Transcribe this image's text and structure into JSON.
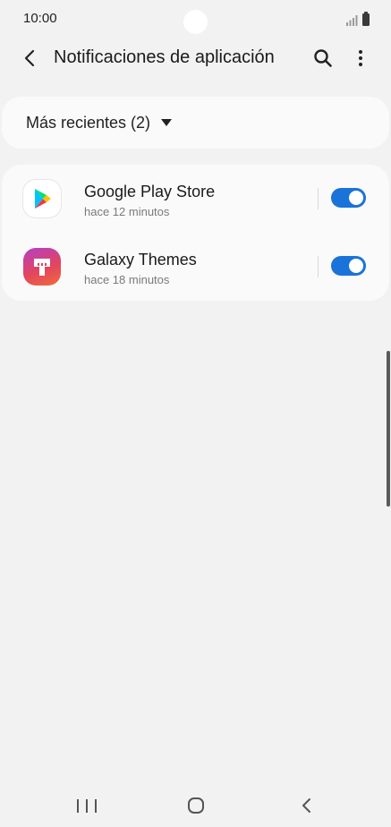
{
  "status_bar": {
    "time": "10:00",
    "icons": [
      "signal-icon",
      "battery-icon"
    ]
  },
  "header": {
    "title": "Notificaciones de aplicación",
    "back_icon": "chevron-left-icon",
    "search_icon": "search-icon",
    "more_icon": "more-vertical-icon"
  },
  "filter": {
    "label": "Más recientes (2)",
    "icon": "caret-down-icon"
  },
  "apps": [
    {
      "name": "Google Play Store",
      "time": "hace 12 minutos",
      "icon": "google-play-icon",
      "enabled": true
    },
    {
      "name": "Galaxy Themes",
      "time": "hace 18 minutos",
      "icon": "galaxy-themes-icon",
      "enabled": true
    }
  ],
  "nav_bar": {
    "recents_icon": "recents-icon",
    "home_icon": "home-icon",
    "back_icon": "back-icon"
  },
  "colors": {
    "background": "#f2f2f2",
    "card": "#fafafa",
    "accent": "#1a73d9"
  }
}
